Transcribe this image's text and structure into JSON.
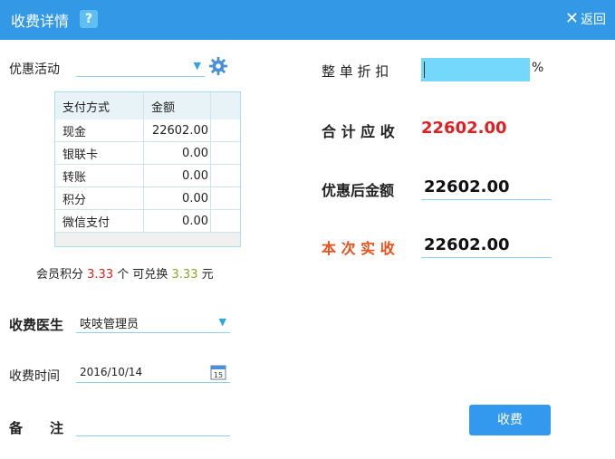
{
  "window": {
    "title": "收费详情",
    "help_glyph": "?",
    "back_label": "返回"
  },
  "promo": {
    "label": "优惠活动",
    "value": ""
  },
  "payment_table": {
    "headers": [
      "支付方式",
      "金额",
      ""
    ],
    "rows": [
      {
        "method": "现金",
        "amount": "22602.00"
      },
      {
        "method": "银联卡",
        "amount": "0.00"
      },
      {
        "method": "转账",
        "amount": "0.00"
      },
      {
        "method": "积分",
        "amount": "0.00"
      },
      {
        "method": "微信支付",
        "amount": "0.00"
      }
    ]
  },
  "points": {
    "prefix": "会员积分",
    "points": "3.33",
    "middle": "个 可兑换",
    "exchange": "3.33",
    "suffix": "元"
  },
  "doctor": {
    "label": "收费医生",
    "value": "吱吱管理员"
  },
  "charge_time": {
    "label": "收费时间",
    "value": "2016/10/14"
  },
  "remark": {
    "label": "备　　注",
    "value": ""
  },
  "discount": {
    "label": "整 单 折 扣",
    "percent_fill": 100,
    "unit": "%"
  },
  "total_due": {
    "label": "合 计 应 收",
    "value": "22602.00"
  },
  "after_discount": {
    "label": "优惠后金额",
    "value": "22602.00"
  },
  "actual": {
    "label": "本 次 实 收",
    "value": "22602.00"
  },
  "submit": {
    "label": "收费"
  },
  "colors": {
    "accent": "#3399e6",
    "alert_red": "#e02020",
    "actual_label": "#e8501c",
    "progress_fill": "#73d8fb"
  }
}
